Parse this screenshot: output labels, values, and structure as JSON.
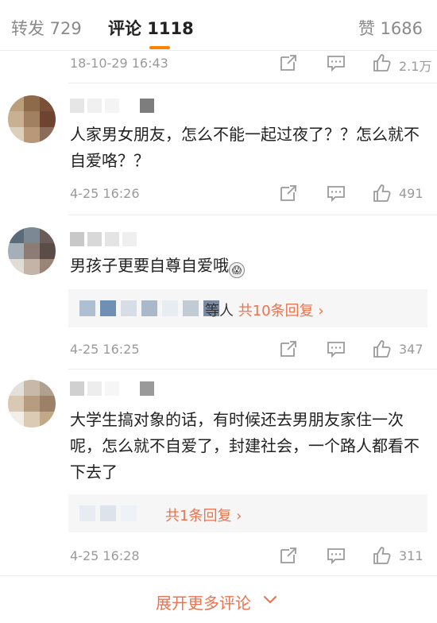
{
  "tabs": {
    "reposts": "转发 729",
    "comments": "评论 1118",
    "likes": "赞 1686",
    "accent": "#ff8200"
  },
  "top_actions": {
    "time": "18-10-29 16:43",
    "likes": "2.1万"
  },
  "comments": [
    {
      "text": "人家男女朋友，怎么不能一起过夜了？？怎么就不自爱咯？？",
      "time": "4-25 16:26",
      "likes": "491"
    },
    {
      "text": "男孩子更要自尊自爱哦",
      "time": "4-25 16:25",
      "likes": "347",
      "reply_people": "等人",
      "reply_link": "共10条回复 ›"
    },
    {
      "text": "大学生搞对象的话，有时候还去男朋友家住一次呢，怎么就不自爱了，封建社会，一个路人都看不下去了",
      "time": "4-25 16:28",
      "likes": "311",
      "reply_link": "共1条回复 ›"
    }
  ],
  "footer": {
    "more_label": "展开更多评论",
    "link_color": "#eb7350"
  },
  "icons": [
    "share-icon",
    "reply-icon",
    "like-icon",
    "chevron-down-icon"
  ]
}
